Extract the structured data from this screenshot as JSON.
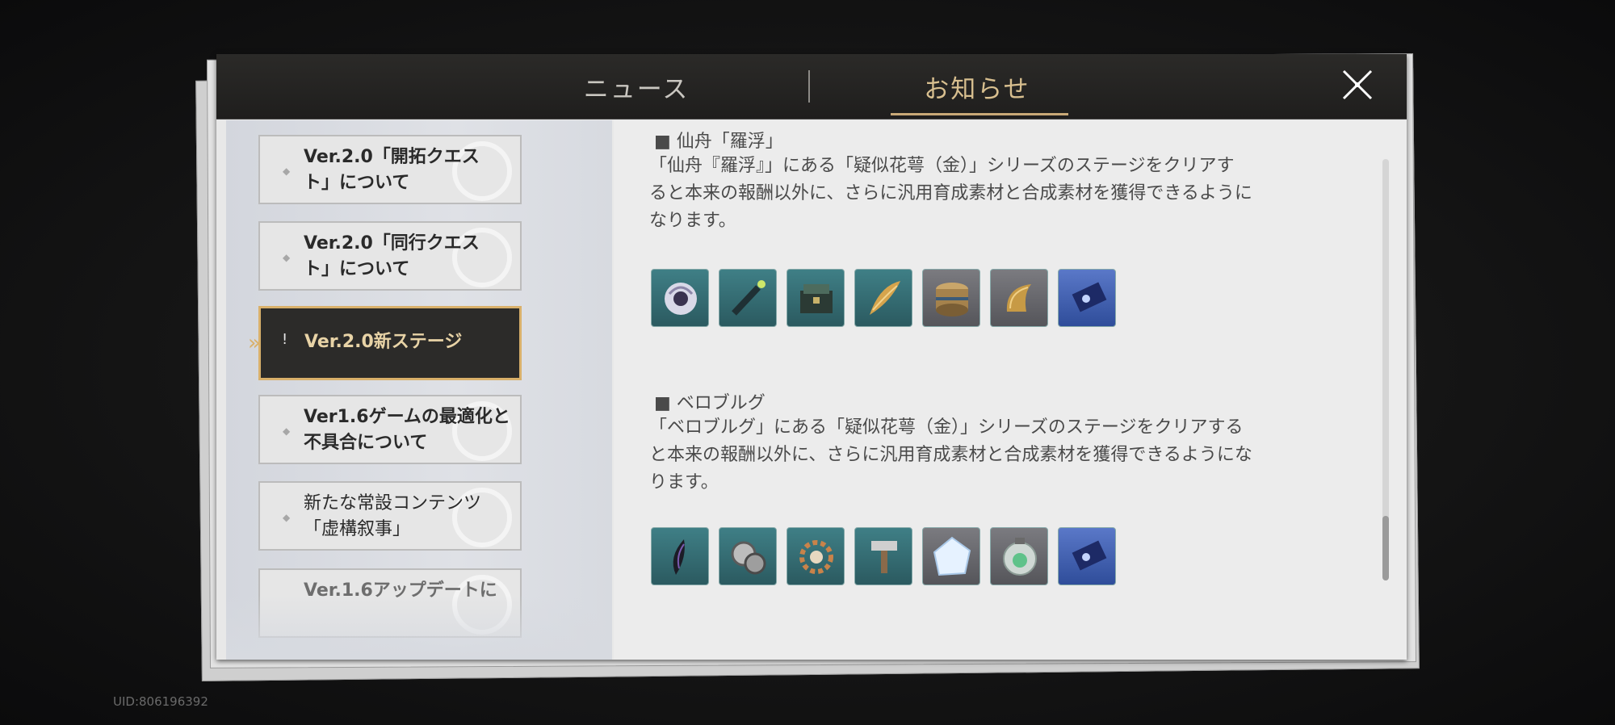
{
  "tabs": [
    {
      "label": "ニュース",
      "selected": false
    },
    {
      "label": "お知らせ",
      "selected": true
    }
  ],
  "sidebar": {
    "items": [
      {
        "line1": "Ver.2.0「開拓クエス",
        "line2": "ト」について",
        "state": "normal"
      },
      {
        "line1": "Ver.2.0「同行クエス",
        "line2": "ト」について",
        "state": "normal"
      },
      {
        "line1": "Ver.2.0新ステージ",
        "line2": "",
        "state": "active",
        "badge": "!"
      },
      {
        "line1": "Ver1.6ゲームの最適化と",
        "line2": "不具合について",
        "state": "normal"
      },
      {
        "line1": "新たな常設コンテンツ",
        "line2": "「虚構叙事」",
        "state": "normal"
      },
      {
        "line1": "Ver.1.6アップデートに",
        "line2": "",
        "state": "dim"
      }
    ]
  },
  "content": {
    "sections": [
      {
        "title": "■ 仙舟「羅浮」",
        "body_lines": [
          "「仙舟『羅浮』」にある「疑似花萼（金）」シリーズのステージをクリアす",
          "ると本来の報酬以外に、さらに汎用育成素材と合成素材を獲得できるように",
          "なります。"
        ],
        "items": [
          "swirl-orb-icon",
          "bone-staff-icon",
          "chest-icon",
          "golden-leaf-icon",
          "cylinder-relic-icon",
          "golden-horn-icon",
          "blue-card-icon"
        ]
      },
      {
        "title": "■ ベロブルグ",
        "body_lines": [
          "「ベロブルグ」にある「疑似花萼（金）」シリーズのステージをクリアする",
          "と本来の報酬以外に、さらに汎用育成素材と合成素材を獲得できるようにな",
          "ります。"
        ],
        "items": [
          "dark-feather-icon",
          "coins-icon",
          "gear-icon",
          "hammer-icon",
          "ice-crystal-icon",
          "green-orb-icon",
          "blue-card-icon"
        ]
      }
    ]
  },
  "uid": "UID:806196392",
  "colors": {
    "accent": "#d9b06a",
    "header_bg": "#2b2a28",
    "active_item_bg": "#2c2b29"
  }
}
